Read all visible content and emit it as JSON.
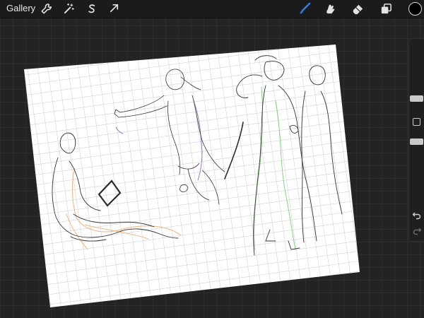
{
  "toolbar": {
    "gallery_label": "Gallery",
    "left_tools": [
      "wrench-icon",
      "magic-wand-icon",
      "selection-s-icon",
      "transform-arrow-icon"
    ],
    "right_tools": [
      "brush-icon",
      "smudge-icon",
      "eraser-icon",
      "layers-icon"
    ],
    "active_tool": "brush-icon",
    "active_color": "#000000",
    "accent_color": "#2f7fe6"
  },
  "sidebar": {
    "controls": [
      "brush-size-slider",
      "modify-button",
      "opacity-slider",
      "undo-icon",
      "redo-icon"
    ]
  },
  "canvas": {
    "paper_color": "#ffffff",
    "grid_color": "#b8b8b8",
    "sketch_colors": [
      "#2b2b2b",
      "#8e6cc4",
      "#7fd07a",
      "#f0b47c"
    ]
  }
}
